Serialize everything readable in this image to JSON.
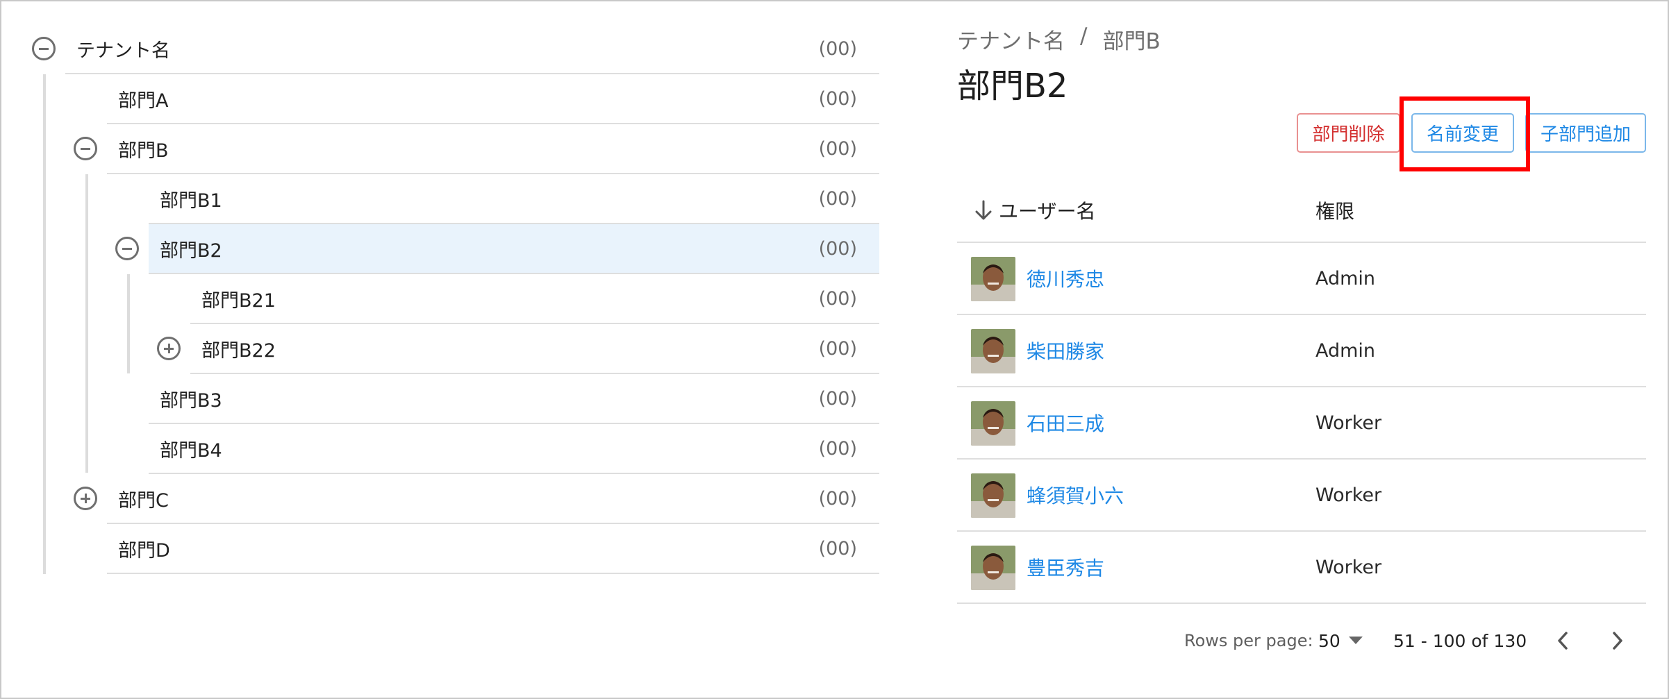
{
  "tree": {
    "nodes": [
      {
        "name": "テナント名",
        "count": "(00)"
      },
      {
        "name": "部門A",
        "count": "(00)"
      },
      {
        "name": "部門B",
        "count": "(00)"
      },
      {
        "name": "部門B1",
        "count": "(00)"
      },
      {
        "name": "部門B2",
        "count": "(00)"
      },
      {
        "name": "部門B21",
        "count": "(00)"
      },
      {
        "name": "部門B22",
        "count": "(00)"
      },
      {
        "name": "部門B3",
        "count": "(00)"
      },
      {
        "name": "部門B4",
        "count": "(00)"
      },
      {
        "name": "部門C",
        "count": "(00)"
      },
      {
        "name": "部門D",
        "count": "(00)"
      }
    ]
  },
  "detail": {
    "breadcrumb": [
      "テナント名",
      "/",
      "部門B"
    ],
    "title": "部門B2",
    "buttons": {
      "delete": "部門削除",
      "rename": "名前変更",
      "add_child": "子部門追加"
    },
    "table": {
      "columns": {
        "user": "ユーザー名",
        "role": "権限"
      },
      "rows": [
        {
          "name": "徳川秀忠",
          "role": "Admin"
        },
        {
          "name": "柴田勝家",
          "role": "Admin"
        },
        {
          "name": "石田三成",
          "role": "Worker"
        },
        {
          "name": "蜂須賀小六",
          "role": "Worker"
        },
        {
          "name": "豊臣秀吉",
          "role": "Worker"
        }
      ]
    },
    "pagination": {
      "rows_per_page_label": "Rows per page:",
      "rows_per_page_value": "50",
      "range": "51 - 100 of 130"
    }
  },
  "icons": {
    "collapse": "minus-circle-icon",
    "expand": "plus-circle-icon",
    "sort": "arrow-down-icon",
    "dropdown": "caret-down-icon",
    "prev": "chevron-left-icon",
    "next": "chevron-right-icon"
  },
  "colors": {
    "accent": "#1e88e5",
    "danger": "#d32f2f",
    "selected_row": "#e9f3fc",
    "annotation": "#ff0000"
  }
}
